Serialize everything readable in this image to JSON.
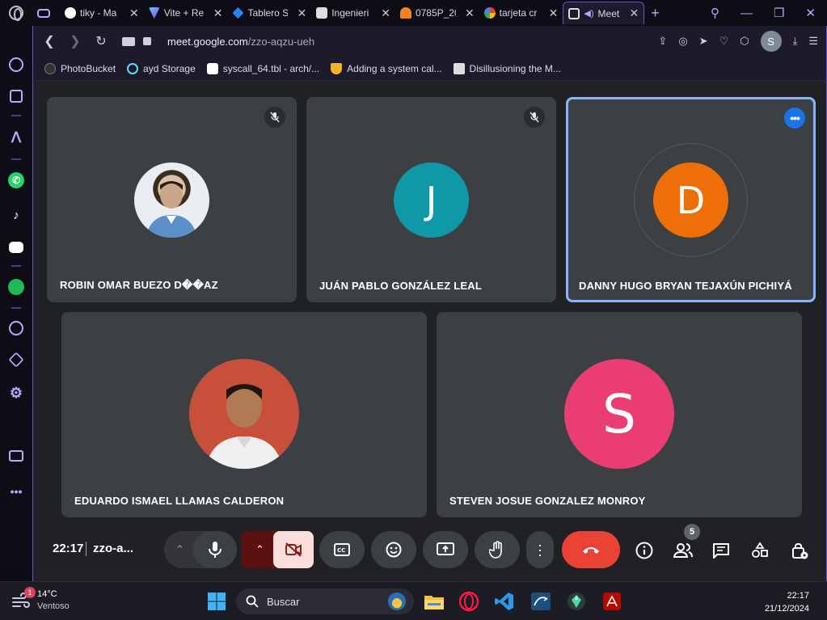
{
  "browser": {
    "tabs": [
      {
        "title": "tiky - Ma",
        "color": "#ffffff"
      },
      {
        "title": "Vite + Re",
        "color": "#a259ff"
      },
      {
        "title": "Tablero S",
        "color": "#2684ff"
      },
      {
        "title": "Ingenieri",
        "color": "#bbbbbb"
      },
      {
        "title": "0785P_20",
        "color": "#f58220"
      },
      {
        "title": "tarjeta cr",
        "color": "#4285f4"
      },
      {
        "title": "Meet",
        "color": "#00ac47"
      }
    ],
    "url_prefix": "meet.google.com",
    "url_path": "/zzo-aqzu-ueh",
    "profile_initial": "S",
    "bookmarks": [
      {
        "label": "PhotoBucket",
        "icon": "photobucket-icon",
        "color": "#222222"
      },
      {
        "label": "ayd Storage",
        "icon": "react-icon",
        "color": "#61dafb"
      },
      {
        "label": "syscall_64.tbl - arch/...",
        "icon": "github-icon",
        "color": "#ffffff"
      },
      {
        "label": "Adding a system cal...",
        "icon": "shield-icon",
        "color": "#f1b429"
      },
      {
        "label": "Disillusioning the M...",
        "icon": "document-icon",
        "color": "#dddddd"
      }
    ]
  },
  "meet": {
    "participants": [
      {
        "name": "ROBIN OMAR BUEZO D��AZ",
        "avatar": "photo",
        "muted": true
      },
      {
        "name": "JUÁN PABLO GONZÁLEZ LEAL",
        "avatar": "letter",
        "initial": "J",
        "color": "#0e98a8",
        "muted": true
      },
      {
        "name": "DANNY HUGO BRYAN TEJAXÚN PICHIYÁ",
        "avatar": "letter",
        "initial": "D",
        "color": "#ee6e08",
        "speaking": true
      },
      {
        "name": "EDUARDO ISMAEL LLAMAS CALDERON",
        "avatar": "photo"
      },
      {
        "name": "STEVEN JOSUE GONZALEZ MONROY",
        "avatar": "letter",
        "initial": "S",
        "color": "#ea3d73"
      }
    ],
    "time": "22:17",
    "meeting_code": "zzo-a...",
    "people_count": "5",
    "more_dots": "•••"
  },
  "taskbar": {
    "weather_temp": "14°C",
    "weather_desc": "Ventoso",
    "notification_count": "1",
    "search_placeholder": "Buscar",
    "clock_time": "22:17",
    "clock_date": "21/12/2024"
  }
}
